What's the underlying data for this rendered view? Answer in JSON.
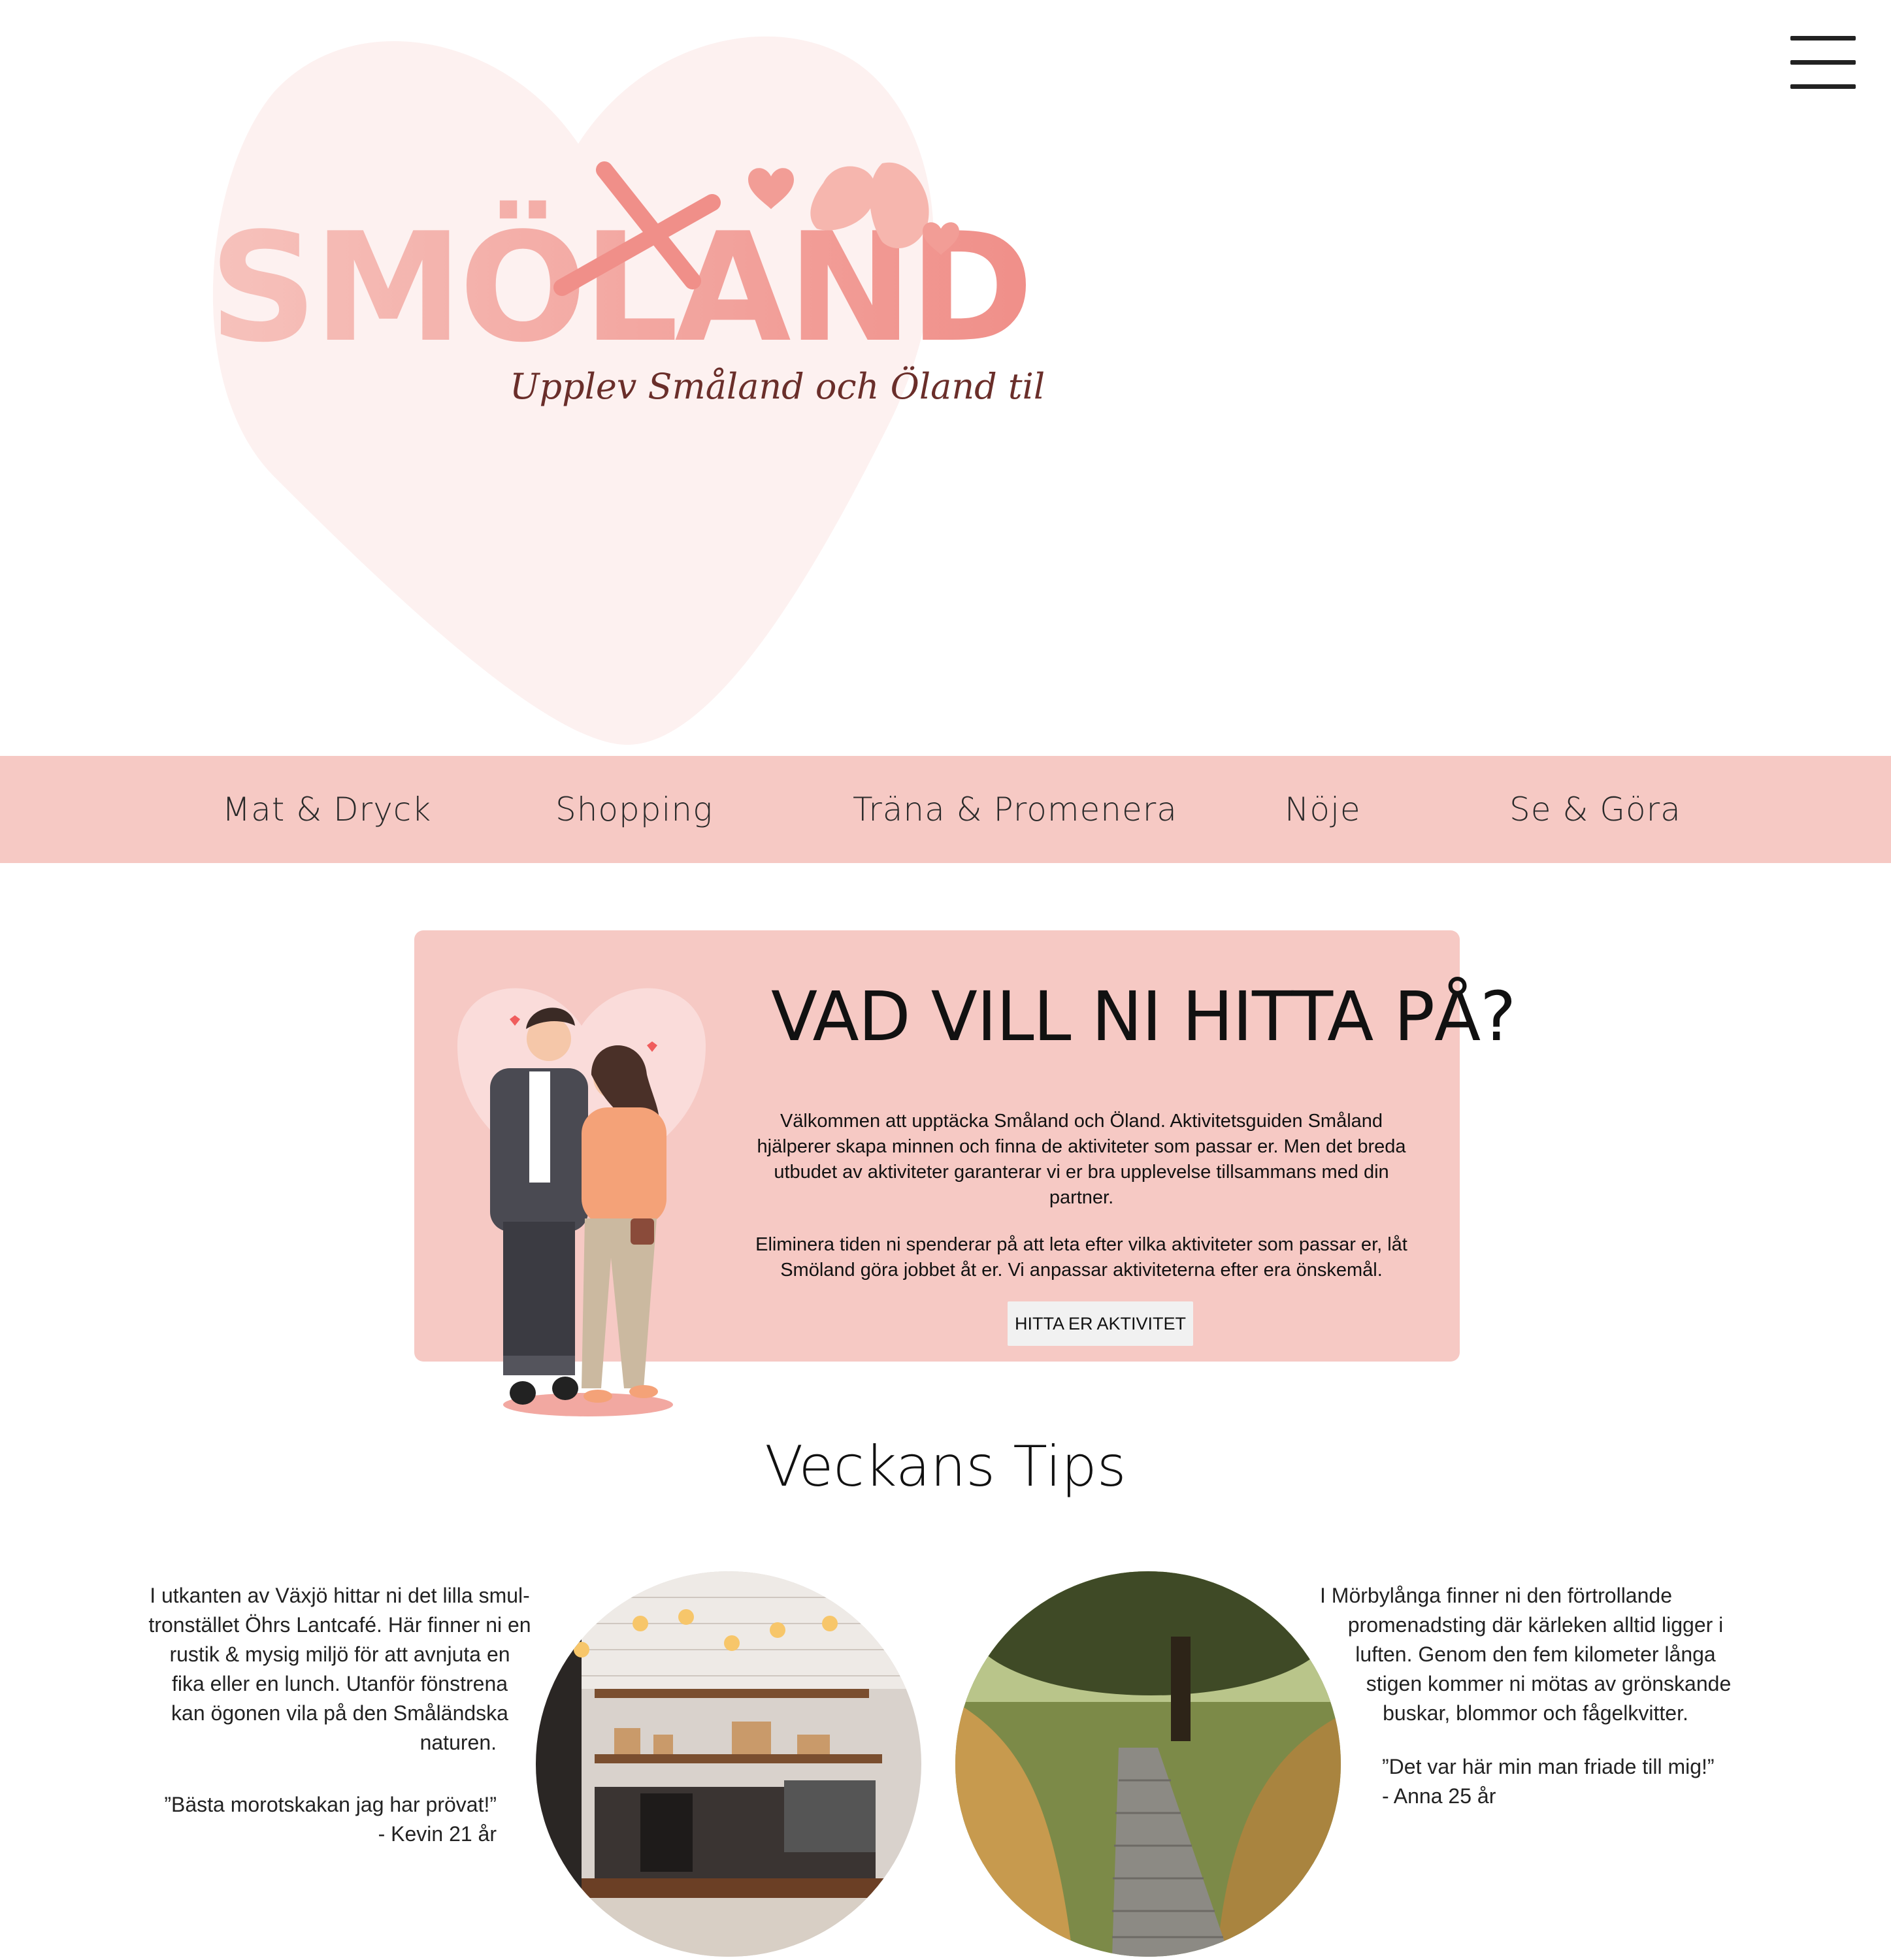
{
  "brand": {
    "logo_text": "SMÖLAND",
    "tagline": "Upplev Småland och Öland tillsammans",
    "accent": "#f6c9c4",
    "logo_pink": "#f3a9a2"
  },
  "nav": {
    "items": [
      {
        "label": "Mat & Dryck"
      },
      {
        "label": "Shopping"
      },
      {
        "label": "Träna & Promenera"
      },
      {
        "label": "Nöje"
      },
      {
        "label": "Se & Göra"
      }
    ]
  },
  "intro": {
    "title": "VAD VILL NI HITTA PÅ?",
    "paragraph1": "Välkommen att upptäcka Småland och Öland. Aktivitetsguiden Småland hjälperer skapa minnen och finna de aktiviteter som passar er. Men det breda utbudet av aktiviteter garanterar vi er bra upplevelse tillsammans med din partner.",
    "paragraph2": "Eliminera tiden ni spenderar på att leta efter vilka aktiviteter som passar er, låt Smöland göra jobbet åt er. Vi anpassar aktiviteterna efter era önskemål.",
    "cta_label": "HITTA ER AKTIVITET"
  },
  "tips": {
    "title": "Veckans Tips",
    "items": [
      {
        "text_lines": [
          "I utkanten av Växjö hittar ni det lilla smul-",
          "tronstället Öhrs Lantcafé. Här finner ni en",
          "rustik & mysig miljö för att avnjuta en",
          "fika eller en lunch. Utanför fönstrena",
          "kan ögonen vila på den Småländska",
          "naturen."
        ],
        "quote": "”Bästa morotskakan jag har prövat!”",
        "author": "- Kevin 21  år"
      },
      {
        "text_lines": [
          "I Mörbylånga finner ni den förtrollande",
          "promenadsting där kärleken alltid ligger i",
          "luften. Genom den fem kilometer långa",
          "stigen kommer ni mötas av grönskande",
          "buskar, blommor och fågelkvitter."
        ],
        "quote": "”Det var här min man friade till mig!”",
        "author": "- Anna 25 år"
      }
    ]
  }
}
